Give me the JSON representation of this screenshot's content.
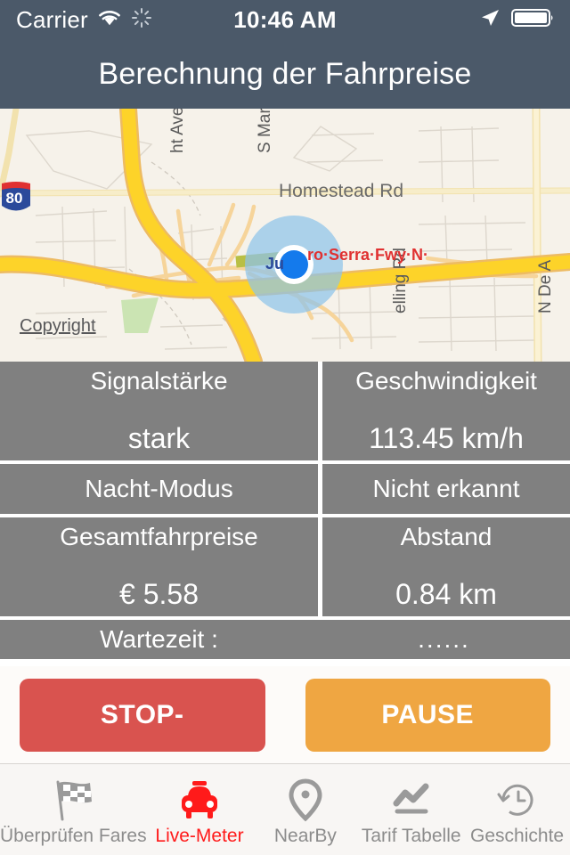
{
  "status_bar": {
    "carrier": "Carrier",
    "time": "10:46 AM",
    "icons": [
      "wifi-icon",
      "activity-spinner-icon",
      "location-arrow-icon",
      "battery-icon"
    ]
  },
  "nav": {
    "title": "Berechnung der Fahrpreise"
  },
  "map": {
    "copyright": "Copyright",
    "labels": [
      "ht Ave",
      "S Mary",
      "Homestead Rd",
      "ro·Serra·Fwy·N",
      "elling Rd",
      "N De A",
      "Ju",
      "80"
    ],
    "colors": {
      "land": "#f7f3ea",
      "highway": "#ffd93b",
      "arterial": "#fbe9a8",
      "park": "#c9e3b4",
      "accuracy_circle": "#8ec4ea",
      "location_dot": "#147aec",
      "shield_red": "#e03131",
      "shield_blue": "#2b4a9b"
    }
  },
  "panel": {
    "rows": [
      {
        "type": "split-tall",
        "left": {
          "label": "Signalstärke",
          "value": "stark"
        },
        "right": {
          "label": "Geschwindigkeit",
          "value": "113.45 km/h"
        }
      },
      {
        "type": "split-short",
        "left": {
          "label": "Nacht-Modus"
        },
        "right": {
          "label": "Nicht erkannt"
        }
      },
      {
        "type": "split-tall",
        "left": {
          "label": "Gesamtfahrpreise",
          "value": "€ 5.58"
        },
        "right": {
          "label": "Abstand",
          "value": "0.84 km"
        }
      }
    ],
    "waiting": {
      "label": "Wartezeit :",
      "value": "......"
    }
  },
  "actions": {
    "stop": {
      "label": "STOP-",
      "color": "#d9534f"
    },
    "pause": {
      "label": "PAUSE",
      "color": "#efa642"
    }
  },
  "tabbar": {
    "active_color": "#ff1a1a",
    "inactive_color": "#8c8c8c",
    "items": [
      {
        "label": "Überprüfen Fares",
        "icon": "checkered-flag-icon",
        "active": false
      },
      {
        "label": "Live-Meter",
        "icon": "taxi-car-icon",
        "active": true
      },
      {
        "label": "NearBy",
        "icon": "map-pin-icon",
        "active": false
      },
      {
        "label": "Tarif Tabelle",
        "icon": "chart-line-icon",
        "active": false
      },
      {
        "label": "Geschichte",
        "icon": "history-clock-icon",
        "active": false
      }
    ]
  }
}
